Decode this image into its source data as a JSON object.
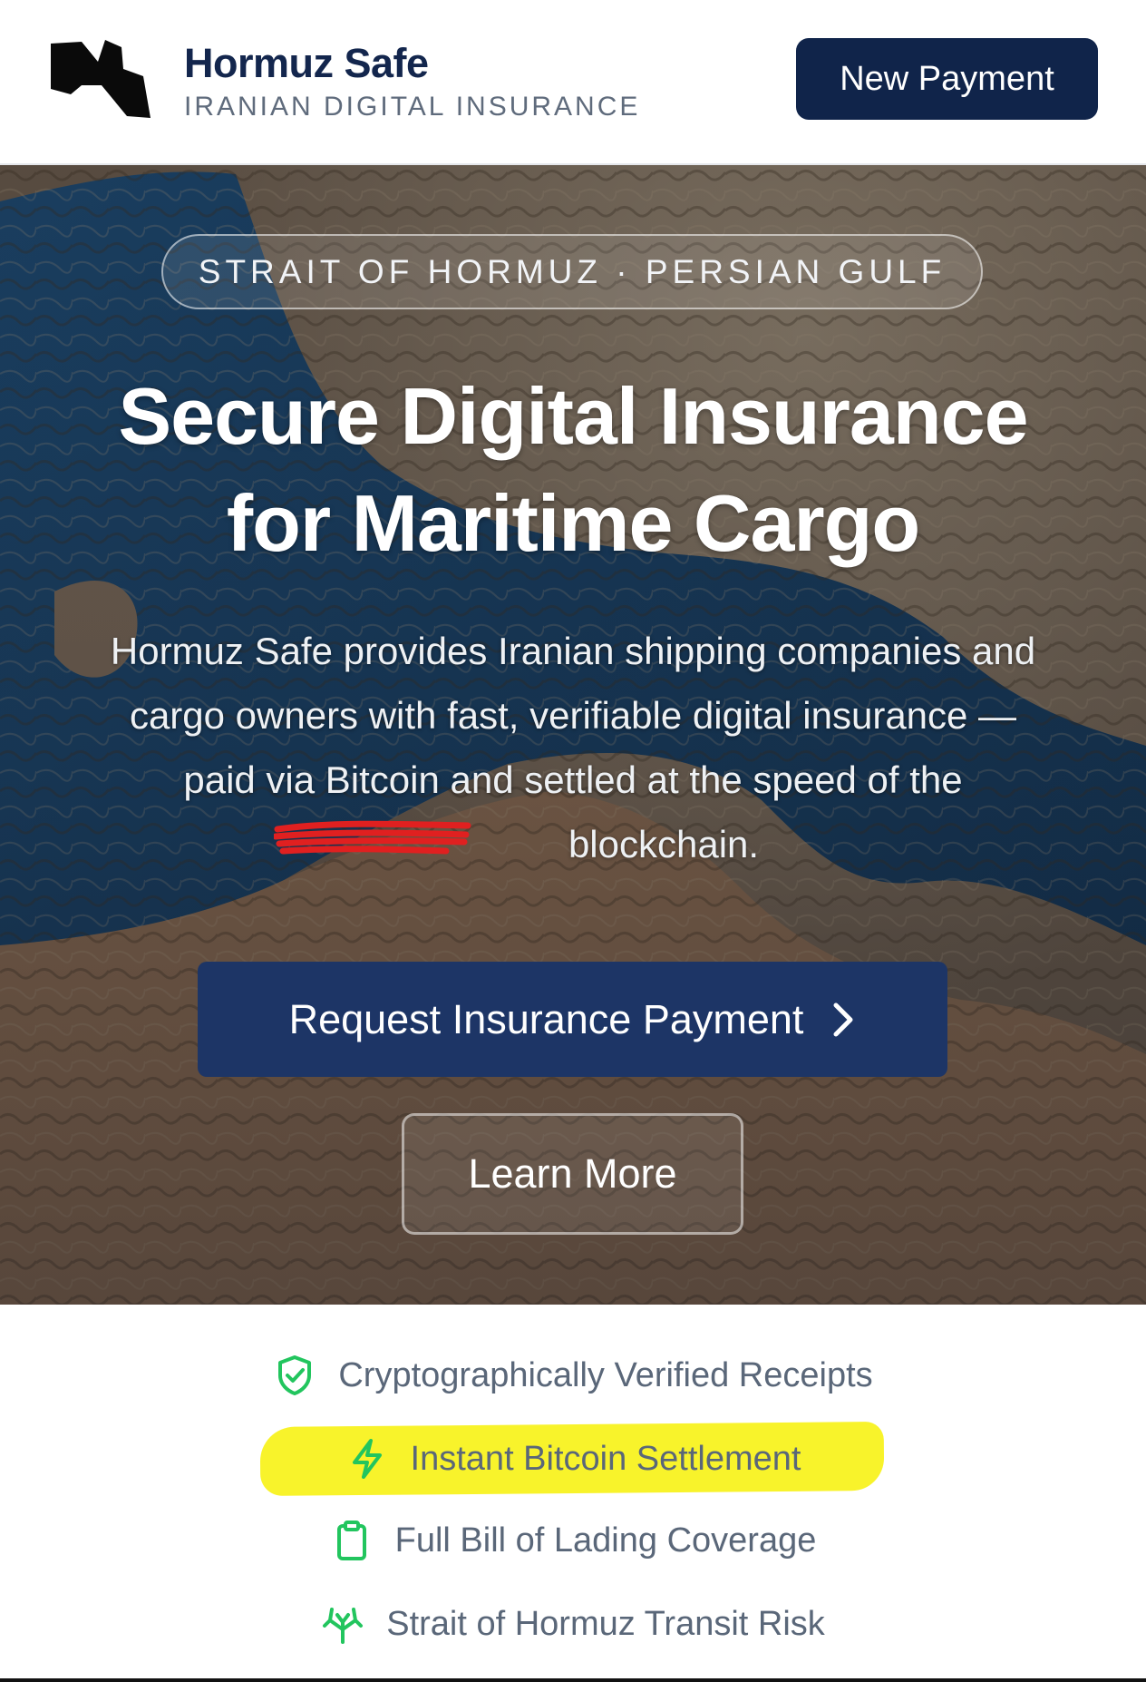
{
  "header": {
    "brand_name": "Hormuz Safe",
    "brand_tagline": "IRANIAN DIGITAL INSURANCE",
    "new_payment_label": "New Payment"
  },
  "hero": {
    "location_pill": "STRAIT OF HORMUZ · PERSIAN GULF",
    "headline_line1": "Secure Digital Insurance",
    "headline_line2": "for Maritime Cargo",
    "description_line1": "Hormuz Safe provides Iranian shipping companies and",
    "description_line2": "cargo owners with fast, verifiable digital insurance —",
    "description_line3": "paid via Bitcoin and settled at the speed of the",
    "description_line4": "blockchain.",
    "primary_cta_label": "Request Insurance Payment",
    "secondary_cta_label": "Learn More"
  },
  "features": [
    {
      "label": "Cryptographically Verified Receipts",
      "icon": "shield-check-icon"
    },
    {
      "label": "Instant Bitcoin Settlement",
      "icon": "lightning-icon"
    },
    {
      "label": "Full Bill of Lading Coverage",
      "icon": "clipboard-icon"
    },
    {
      "label": "Strait of Hormuz Transit Risk",
      "icon": "network-icon"
    }
  ],
  "colors": {
    "brand_navy": "#13264d",
    "primary_button": "#1d3566",
    "feature_icon_green": "#22c55e",
    "highlight_yellow": "#f8f32b",
    "redaction_red": "#e02020"
  }
}
